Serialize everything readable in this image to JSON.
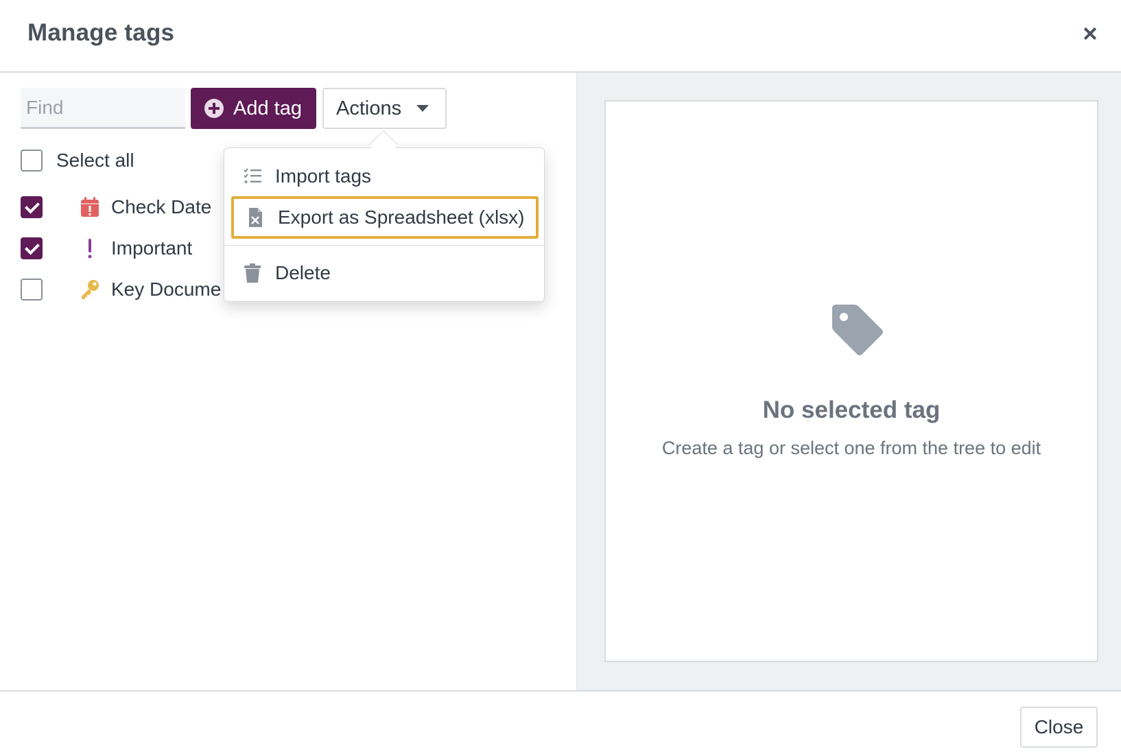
{
  "dialog": {
    "title": "Manage tags",
    "close_icon": "close-icon"
  },
  "toolbar": {
    "find_placeholder": "Find",
    "find_value": "",
    "add_tag_label": "Add tag",
    "add_tag_icon": "plus-circle-icon",
    "actions_label": "Actions",
    "accent_color": "#5e1b56"
  },
  "tags": {
    "select_all_label": "Select all",
    "select_all_checked": false,
    "items": [
      {
        "label": "Check Date",
        "icon": "calendar-alert-icon",
        "icon_color": "#e06060",
        "checked": true
      },
      {
        "label": "Important",
        "icon": "exclamation-icon",
        "icon_color": "#8e3a9c",
        "checked": true
      },
      {
        "label": "Key Docume",
        "icon": "key-icon",
        "icon_color": "#e8b84a",
        "checked": false
      }
    ]
  },
  "actions_menu": {
    "items": [
      {
        "label": "Import tags",
        "icon": "checklist-icon"
      },
      {
        "label": "Export as Spreadsheet (xlsx)",
        "icon": "excel-file-icon",
        "highlighted": true
      },
      {
        "label": "Delete",
        "icon": "trash-icon"
      }
    ],
    "highlight_color": "#e3ad3b"
  },
  "detail": {
    "empty_icon": "tag-icon",
    "empty_title": "No selected tag",
    "empty_subtitle": "Create a tag or select one from the tree to edit"
  },
  "footer": {
    "close_label": "Close"
  }
}
